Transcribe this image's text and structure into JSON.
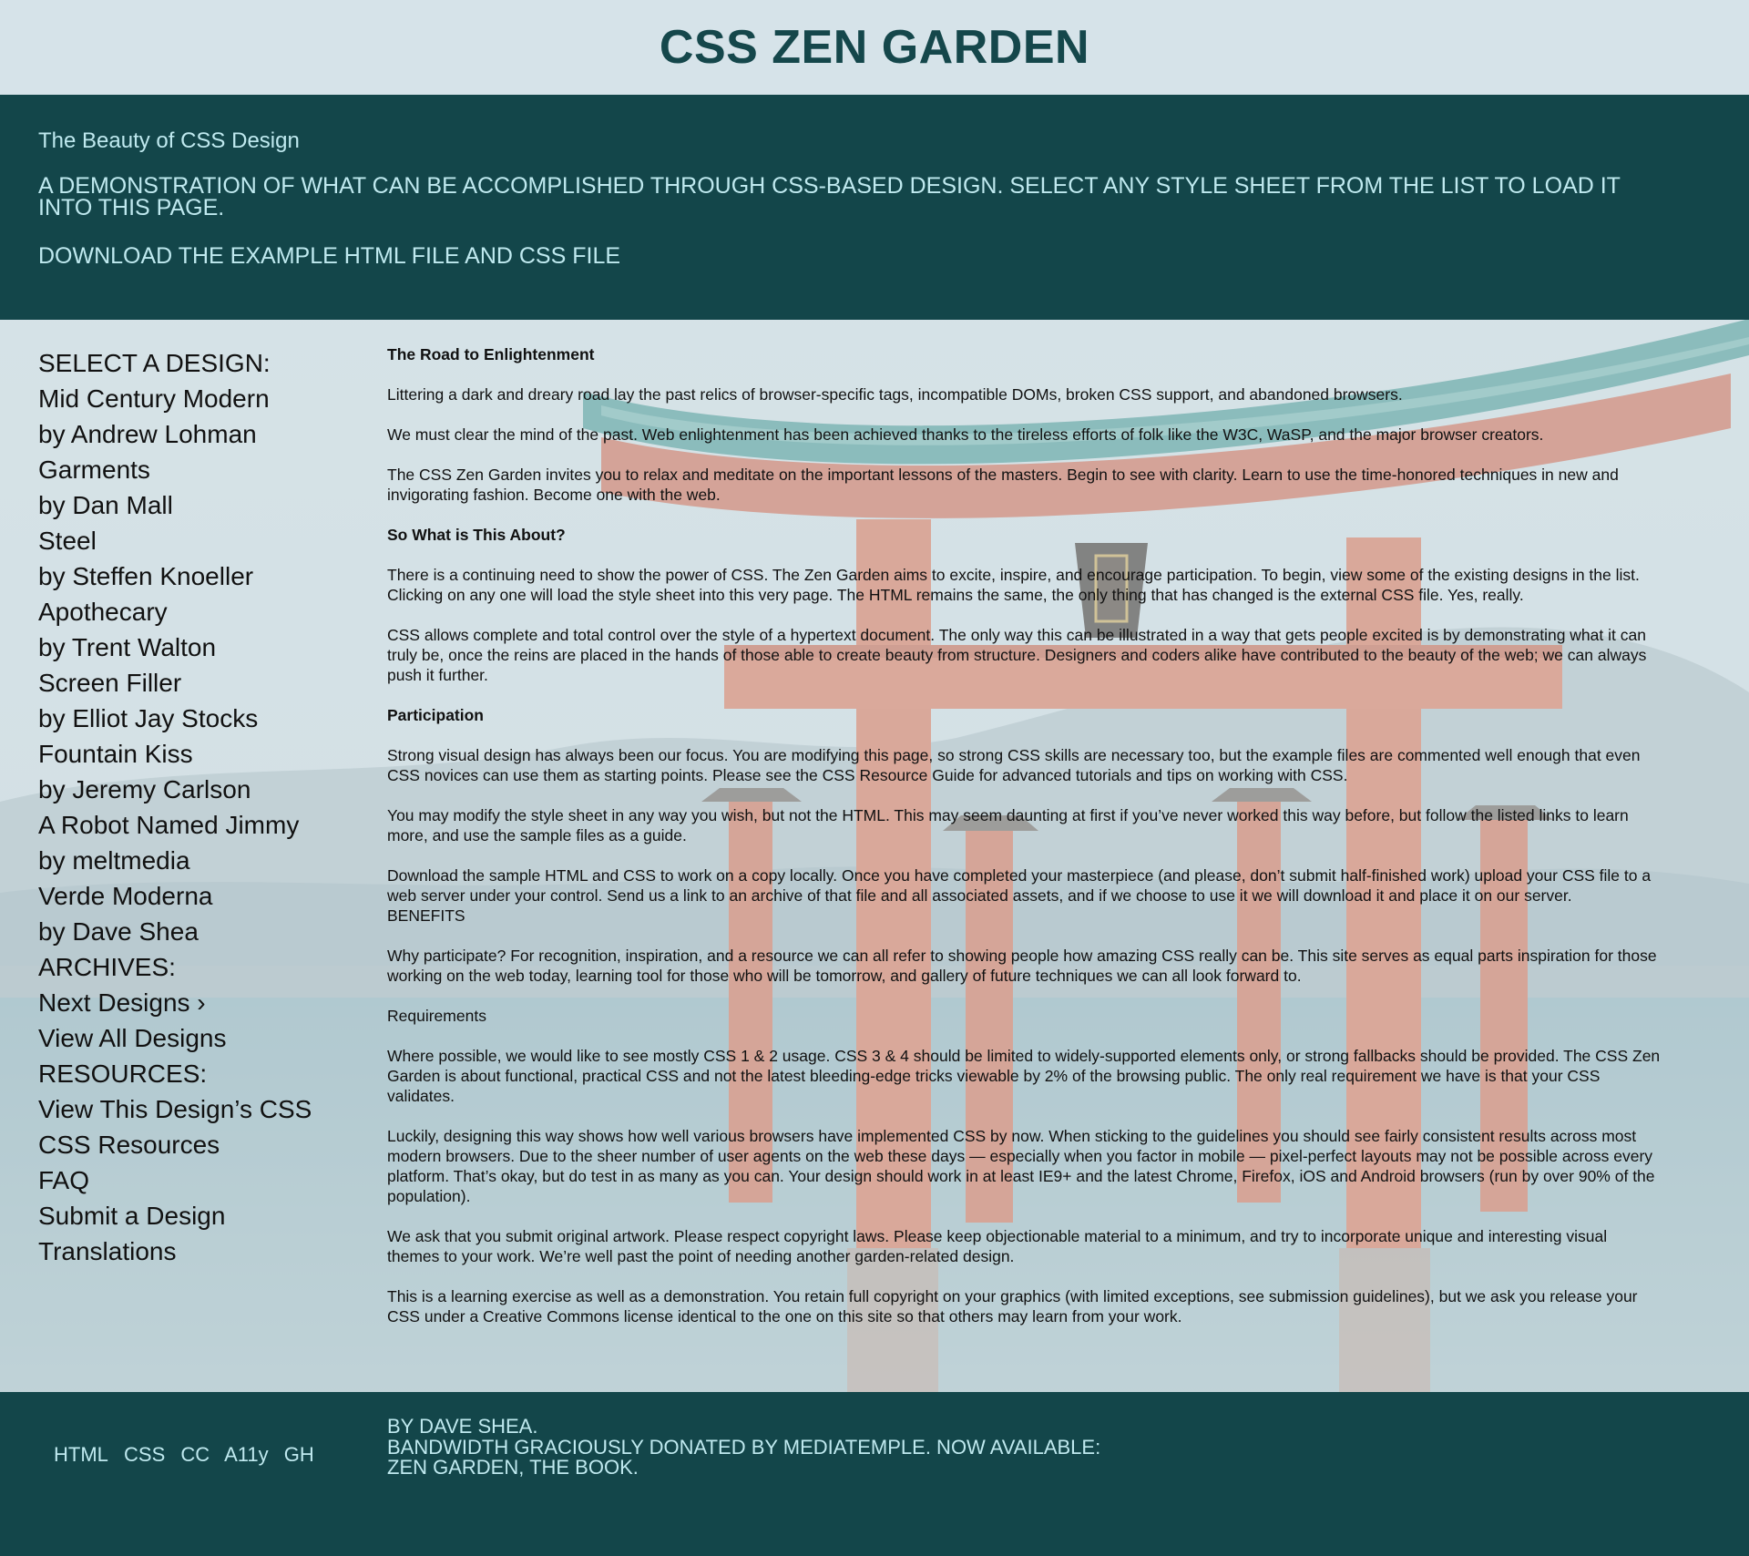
{
  "header": {
    "title": "CSS ZEN GARDEN"
  },
  "intro": {
    "tagline": "The Beauty of CSS Design",
    "summary": "A demonstration of what can be accomplished through CSS-based design. Select any style sheet from the list to load it into this page.",
    "download": "Download the example HTML FILE and CSS FILE"
  },
  "sidebar": {
    "select_heading": "Select a Design:",
    "designs": [
      {
        "name": "Mid Century Modern",
        "author": "by Andrew Lohman"
      },
      {
        "name": "Garments",
        "author": "by Dan Mall"
      },
      {
        "name": "Steel",
        "author": "by Steffen Knoeller"
      },
      {
        "name": "Apothecary",
        "author": "by Trent Walton"
      },
      {
        "name": "Screen Filler",
        "author": "by Elliot Jay Stocks"
      },
      {
        "name": "Fountain Kiss",
        "author": "by Jeremy Carlson"
      },
      {
        "name": "A Robot Named Jimmy",
        "author": "by meltmedia"
      },
      {
        "name": "Verde Moderna",
        "author": "by Dave Shea"
      }
    ],
    "archives_heading": "Archives:",
    "next_designs": "Next Designs ›",
    "view_all": "View All Designs",
    "resources_heading": "Resources:",
    "resources": [
      "View This Design’s CSS",
      "CSS Resources",
      "FAQ",
      "Submit a Design",
      "Translations"
    ]
  },
  "main": {
    "s1_title": "The Road to Enlightenment",
    "s1_p1": "Littering a dark and dreary road lay the past relics of browser-specific tags, incompatible DOMs, broken CSS support, and abandoned browsers.",
    "s1_p2": "We must clear the mind of the past. Web enlightenment has been achieved thanks to the tireless efforts of folk like the W3C, WaSP, and the major browser creators.",
    "s1_p3": "The CSS Zen Garden invites you to relax and meditate on the important lessons of the masters. Begin to see with clarity. Learn to use the time-honored techniques in new and invigorating fashion. Become one with the web.",
    "s2_title": "So What is This About?",
    "s2_p1": "There is a continuing need to show the power of CSS. The Zen Garden aims to excite, inspire, and encourage participation. To begin, view some of the existing designs in the list. Clicking on any one will load the style sheet into this very page. The HTML remains the same, the only thing that has changed is the external CSS file. Yes, really.",
    "s2_p2": "CSS allows complete and total control over the style of a hypertext document. The only way this can be illustrated in a way that gets people excited is by demonstrating what it can truly be, once the reins are placed in the hands of those able to create beauty from structure. Designers and coders alike have contributed to the beauty of the web; we can always push it further.",
    "s3_title": "Participation",
    "s3_p1": "Strong visual design has always been our focus. You are modifying this page, so strong CSS skills are necessary too, but the example files are commented well enough that even CSS novices can use them as starting points. Please see the CSS Resource Guide for advanced tutorials and tips on working with CSS.",
    "s3_p2": "You may modify the style sheet in any way you wish, but not the HTML. This may seem daunting at first if you’ve never worked this way before, but follow the listed links to learn more, and use the sample files as a guide.",
    "s3_p3": "Download the sample HTML and CSS to work on a copy locally. Once you have completed your masterpiece (and please, don’t submit half-finished work) upload your CSS file to a web server under your control. Send us a link to an archive of that file and all associated assets, and if we choose to use it we will download it and place it on our server.",
    "s4_title": "Benefits",
    "s4_p1": "Why participate? For recognition, inspiration, and a resource we can all refer to showing people how amazing CSS really can be. This site serves as equal parts inspiration for those working on the web today, learning tool for those who will be tomorrow, and gallery of future techniques we can all look forward to.",
    "s5_title": "Requirements",
    "s5_p1": "Where possible, we would like to see mostly CSS 1 & 2 usage. CSS 3 & 4 should be limited to widely-supported elements only, or strong fallbacks should be provided. The CSS Zen Garden is about functional, practical CSS and not the latest bleeding-edge tricks viewable by 2% of the browsing public. The only real requirement we have is that your CSS validates.",
    "s5_p2": "Luckily, designing this way shows how well various browsers have implemented CSS by now. When sticking to the guidelines you should see fairly consistent results across most modern browsers. Due to the sheer number of user agents on the web these days — especially when you factor in mobile — pixel-perfect layouts may not be possible across every platform. That’s okay, but do test in as many as you can. Your design should work in at least IE9+ and the latest Chrome, Firefox, iOS and Android browsers (run by over 90% of the population).",
    "s5_p3": "We ask that you submit original artwork. Please respect copyright laws. Please keep objectionable material to a minimum, and try to incorporate unique and interesting visual themes to your work. We’re well past the point of needing another garden-related design.",
    "s5_p4": "This is a learning exercise as well as a demonstration. You retain full copyright on your graphics (with limited exceptions, see submission guidelines), but we ask you release your CSS under a Creative Commons license identical to the one on this site so that others may learn from your work."
  },
  "footer": {
    "links": [
      "HTML",
      "CSS",
      "CC",
      "A11y",
      "GH"
    ],
    "credit_line1": "By Dave Shea.",
    "credit_line2": "Bandwidth graciously donated by mediatemple. Now available:",
    "credit_line3": "Zen Garden, the Book."
  },
  "colors": {
    "dark_teal": "#13464a",
    "light_text": "#bfe9ef",
    "title_teal": "#15474b",
    "header_bg": "#d6e3e9",
    "torii_red": "#c8664d",
    "roof_teal": "#3a8f8c"
  },
  "background_image": "torii gate standing in water with mountains behind"
}
